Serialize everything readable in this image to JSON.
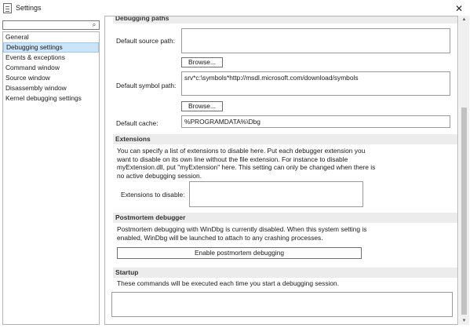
{
  "window": {
    "title": "Settings",
    "close_glyph": "✕",
    "icon": "settings-document-icon"
  },
  "search": {
    "placeholder": "",
    "icon": "search-icon"
  },
  "nav": {
    "items": [
      {
        "label": "General"
      },
      {
        "label": "Debugging settings",
        "selected": true
      },
      {
        "label": "Events & exceptions"
      },
      {
        "label": "Command window"
      },
      {
        "label": "Source window"
      },
      {
        "label": "Disassembly window"
      },
      {
        "label": "Kernel debugging settings"
      }
    ]
  },
  "debugging_paths": {
    "header": "Debugging paths",
    "source_label": "Default source path:",
    "source_value": "",
    "browse_label": "Browse...",
    "symbol_label": "Default symbol path:",
    "symbol_value": "srv*c:\\symbols*http://msdl.microsoft.com/download/symbols",
    "browse2_label": "Browse...",
    "cache_label": "Default cache:",
    "cache_value": "%PROGRAMDATA%\\Dbg"
  },
  "extensions": {
    "header": "Extensions",
    "lines": [
      "You can specify a list of extensions to disable here. Put each debugger extension you",
      "want to disable on its own line without the file extension. For instance to disable",
      "myExtension.dll, put \"myExtension\" here. This setting can only be changed when there is",
      "no active debugging session."
    ],
    "disable_label": "Extensions to disable:",
    "disable_value": ""
  },
  "postmortem": {
    "header": "Postmortem debugger",
    "lines": [
      "Postmortem debugging with WinDbg is currently disabled. When this system setting is",
      "enabled, WinDbg will be launched to attach to any crashing processes."
    ],
    "button_label": "Enable postmortem debugging"
  },
  "startup": {
    "header": "Startup",
    "line": "These commands will be executed each time you start a debugging session.",
    "commands_value": ""
  },
  "scrollbar": {
    "up_glyph": "▲",
    "down_glyph": "▼",
    "position_fraction": 0.3
  },
  "colors": {
    "selected_bg": "#cce4f7",
    "section_bg": "#ececec",
    "thumb": "#c2c2c2"
  }
}
